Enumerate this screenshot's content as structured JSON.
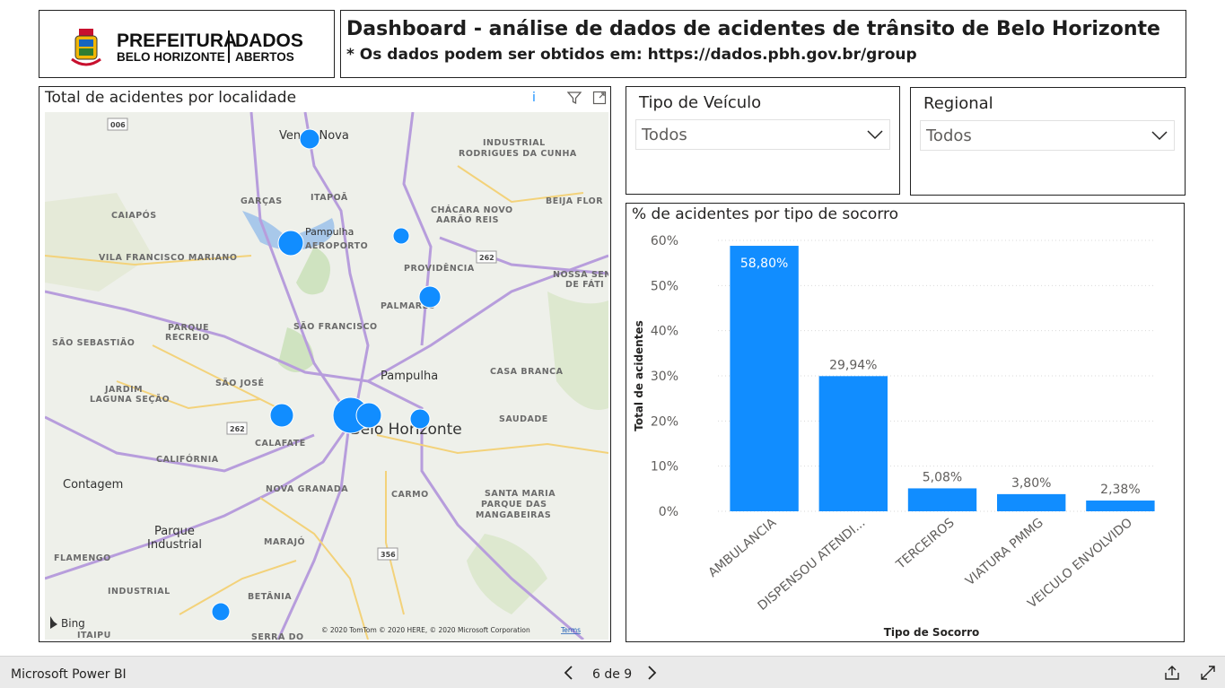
{
  "header": {
    "logo": {
      "line1": "PREFEITURA",
      "line2": "BELO HORIZONTE",
      "word1": "DADOS",
      "word2": "ABERTOS",
      "colors": {
        "crest_red": "#c8102e",
        "crest_gold": "#f2b705",
        "crest_green": "#2e7d32",
        "crest_blue": "#1565c0"
      }
    },
    "title": "Dashboard - análise de dados de acidentes de trânsito de Belo Horizonte",
    "subtitle": "* Os dados podem ser obtidos em: https://dados.pbh.gov.br/group"
  },
  "map": {
    "title": "Total de acidentes por localidade",
    "icons": [
      "info-icon",
      "filter-icon",
      "focus-mode-icon"
    ],
    "info_glyph": "i",
    "provider": "Bing",
    "attribution": "© 2020 TomTom © 2020 HERE, © 2020 Microsoft Corporation",
    "terms": "Terms",
    "labels": {
      "venda_nova": "Venda Nova",
      "industrial_rodrigues": "INDUSTRIAL",
      "rodrigues": "RODRIGUES DA CUNHA",
      "garcas": "GARÇAS",
      "itapoa": "ITAPOÃ",
      "beija_flor": "BEIJA FLOR",
      "caiapos": "CAIAPÓS",
      "chacara": "CHÁCARA NOVO",
      "aarao": "AARÃO REIS",
      "pampulha_top": "Pampulha",
      "aeroporto": "AEROPORTO",
      "vila_francisco": "VILA FRANCISCO MARIANO",
      "providencia": "PROVIDÊNCIA",
      "nossa_senhora": "NOSSA SENHORA",
      "de_fatima": "DE FÁTI",
      "palmares": "PALMARES",
      "parque": "PARQUE",
      "recreio": "RECREIO",
      "sao_francisco": "SÃO FRANCISCO",
      "sao_sebastiao": "SÃO SEBASTIÃO",
      "pampulha_mid": "Pampulha",
      "casa_branca": "CASA BRANCA",
      "jardim": "JARDIM",
      "laguna": "LAGUNA SEÇÃO",
      "sao_jose": "SÃO JOSÉ",
      "saudade": "SAUDADE",
      "calafate": "CALAFATE",
      "belo_horizonte": "Belo Horizonte",
      "california": "CALIFÓRNIA",
      "contagem": "Contagem",
      "nova_granada": "NOVA GRANADA",
      "carmo": "CARMO",
      "santa_maria": "SANTA MARIA",
      "parque_das": "PARQUE DAS",
      "mangabeiras": "MANGABEIRAS",
      "parque_ind": "Parque",
      "industrial": "Industrial",
      "flamengo": "FLAMENGO",
      "marajo": "MARAJÓ",
      "industrial2": "INDUSTRIAL",
      "betania": "BETÂNIA",
      "itaipu": "ITAIPU",
      "serra_do": "SERRA DO",
      "road_006": "006",
      "road_262a": "262",
      "road_262b": "262",
      "road_356": "356"
    },
    "bubble_color": "#118dff"
  },
  "slicers": {
    "vehicle": {
      "title": "Tipo de Veículo",
      "value": "Todos"
    },
    "regional": {
      "title": "Regional",
      "value": "Todos"
    }
  },
  "chart_data": {
    "type": "bar",
    "title": "% de acidentes por tipo de socorro",
    "categories": [
      "AMBULANCIA",
      "DISPENSOU ATENDI...",
      "TERCEIROS",
      "VIATURA PMMG",
      "VEICULO ENVOLVIDO"
    ],
    "values": [
      58.8,
      29.94,
      5.08,
      3.8,
      2.38
    ],
    "data_labels": [
      "58,80%",
      "29,94%",
      "5,08%",
      "3,80%",
      "2,38%"
    ],
    "yticks": [
      "0%",
      "10%",
      "20%",
      "30%",
      "40%",
      "50%",
      "60%"
    ],
    "ylim": [
      0,
      60
    ],
    "xlabel": "Tipo de Socorro",
    "ylabel": "Total de acidentes",
    "grid": true,
    "bar_color": "#118dff"
  },
  "footer": {
    "brand": "Microsoft Power BI",
    "page": "6 de 9",
    "icons": [
      "prev-page-icon",
      "next-page-icon",
      "share-icon",
      "fullscreen-icon"
    ]
  }
}
